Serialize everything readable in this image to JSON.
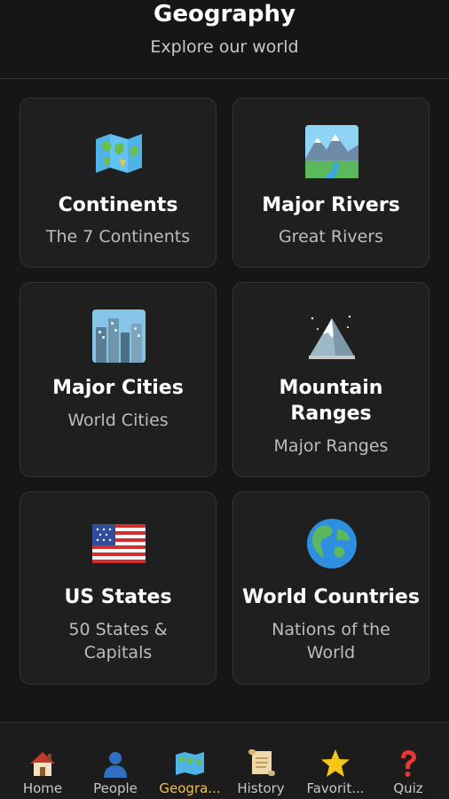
{
  "header": {
    "title": "Geography",
    "subtitle": "Explore our world"
  },
  "cards": [
    {
      "title": "Continents",
      "subtitle": "The 7 Continents",
      "icon": "world-map-icon"
    },
    {
      "title": "Major Rivers",
      "subtitle": "Great Rivers",
      "icon": "river-landscape-icon"
    },
    {
      "title": "Major Cities",
      "subtitle": "World Cities",
      "icon": "cityscape-icon"
    },
    {
      "title": "Mountain Ranges",
      "subtitle": "Major Ranges",
      "icon": "snow-mountain-icon"
    },
    {
      "title": "US States",
      "subtitle": "50 States & Capitals",
      "icon": "us-flag-icon"
    },
    {
      "title": "World Countries",
      "subtitle": "Nations of the World",
      "icon": "globe-icon"
    }
  ],
  "nav": {
    "items": [
      {
        "label": "Home",
        "icon": "house-icon"
      },
      {
        "label": "People",
        "icon": "person-silhouette-icon"
      },
      {
        "label": "Geogra...",
        "icon": "world-map-icon",
        "active": true
      },
      {
        "label": "History",
        "icon": "scroll-icon"
      },
      {
        "label": "Favorit...",
        "icon": "star-icon"
      },
      {
        "label": "Quiz",
        "icon": "question-mark-icon"
      }
    ]
  },
  "colors": {
    "background": "#161616",
    "card": "#1f1f1f",
    "active_tab": "#f2c14e"
  }
}
